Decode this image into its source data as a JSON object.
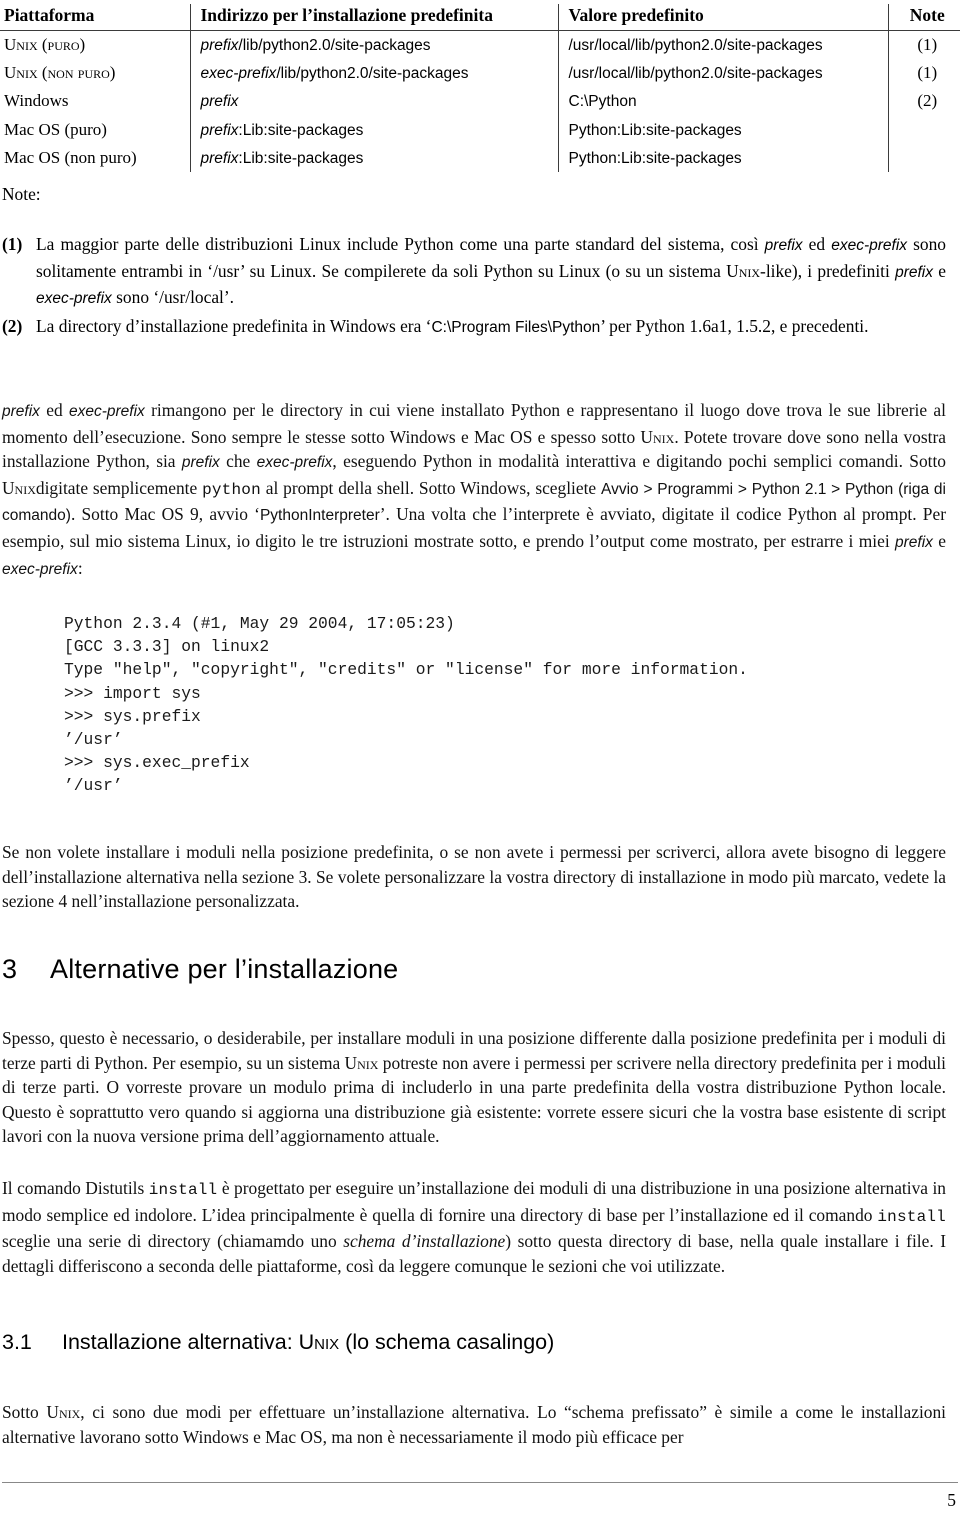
{
  "document": {
    "page_number": "5"
  },
  "table": {
    "headers": [
      "Piattaforma",
      "Indirizzo per l’installazione predefinita",
      "Valore predefinito",
      "Note"
    ],
    "rows": [
      {
        "platform": "Unix (puro)",
        "path_em": "prefix",
        "path_rest": "/lib/python2.0/site-packages",
        "default": "/usr/local/lib/python2.0/site-packages",
        "note": "(1)"
      },
      {
        "platform": "Unix (non puro)",
        "path_em": "exec-prefix",
        "path_rest": "/lib/python2.0/site-packages",
        "default": "/usr/local/lib/python2.0/site-packages",
        "note": "(1)"
      },
      {
        "platform": "Windows",
        "path_em": "prefix",
        "path_rest": "",
        "default": "C:\\Python",
        "note": "(2)"
      },
      {
        "platform": "Mac OS (puro)",
        "path_em": "prefix",
        "path_rest": ":Lib:site-packages",
        "default": "Python:Lib:site-packages",
        "note": ""
      },
      {
        "platform": "Mac OS (non puro)",
        "path_em": "prefix",
        "path_rest": ":Lib:site-packages",
        "default": "Python:Lib:site-packages",
        "note": ""
      }
    ]
  },
  "notes": {
    "label": "Note:",
    "items": [
      {
        "marker": "(1)",
        "p1": "La maggior parte delle distribuzioni Linux include Python come una parte standard del sistema, così ",
        "em1": "prefix",
        "p2": " ed ",
        "em2": "exec-prefix",
        "p3": " sono solitamente entrambi in ‘/usr’ su Linux. Se compilerete da soli Python su Linux (o su un sistema ",
        "sc1": "Unix",
        "p4": "-like), i predefiniti ",
        "em3": "prefix",
        "p5": " e ",
        "em4": "exec-prefix",
        "p6": " sono ‘/usr/local’."
      },
      {
        "marker": "(2)",
        "p1": "La directory d’installazione predefinita in Windows era ‘",
        "em1": "C:\\Program Files\\Python",
        "p2": "’ per Python 1.6a1, 1.5.2, e precedenti."
      }
    ]
  },
  "prefix_paragraph": {
    "em1": "prefix",
    "t1": " ed ",
    "em2": "exec-prefix",
    "t2": " rimangono per le directory in cui viene installato Python e rappresentano il luogo dove trova le sue librerie al momento dell’esecuzione. Sono sempre le stesse sotto Windows e Mac OS e spesso sotto ",
    "sc1": "Unix",
    "t3": ". Potete trovare dove sono nella vostra installazione Python, sia ",
    "em3": "prefix",
    "t4": " che ",
    "em4": "exec-prefix",
    "t5": ", eseguendo Python in modalità interattiva e digitando pochi semplici comandi. Sotto ",
    "sc2": "Unix",
    "t6": "digitate semplicemente ",
    "code1": "python",
    "t7": " al prompt della shell. Sotto Windows, scegliete ",
    "menu": "Avvio  >  Programmi  >  Python 2.1  >  Python (riga di comando)",
    "t8": ". Sotto Mac OS 9, avvio ‘",
    "menu2": "PythonInterpreter",
    "t9": "’. Una volta che l’interprete è avviato, digitate il codice Python al prompt. Per esempio, sul mio sistema Linux, io digito le tre istruzioni mostrate sotto, e prendo l’output come mostrato, per estrarre i miei ",
    "em5": "prefix",
    "t10": " e ",
    "em6": "exec-prefix",
    "t11": ":"
  },
  "code_block": {
    "lines": [
      "Python 2.3.4 (#1, May 29 2004, 17:05:23)",
      "[GCC 3.3.3] on linux2",
      "Type \"help\", \"copyright\", \"credits\" or \"license\" for more information.",
      ">>> import sys",
      ">>> sys.prefix",
      "’/usr’",
      ">>> sys.exec_prefix",
      "’/usr’"
    ]
  },
  "alt_install_paragraph": {
    "text": "Se non volete installare i moduli nella posizione predefinita, o se non avete i permessi per scriverci, allora avete bisogno di leggere dell’installazione alternativa nella sezione  3. Se volete personalizzare la vostra directory di installazione in modo più marcato, vedete la sezione  4 nell’installazione personalizzata."
  },
  "section3": {
    "number": "3",
    "title": "Alternative per l’installazione",
    "para1": {
      "t1": "Spesso, questo è necessario, o desiderabile, per installare moduli in una posizione differente dalla posizione predefinita per i moduli di terze parti di Python. Per esempio, su un sistema ",
      "sc1": "Unix",
      "t2": " potreste non avere i permessi per scrivere nella directory predefinita per i moduli di terze parti. O vorreste provare un modulo prima di includerlo in una parte predefinita della vostra distribuzione Python locale. Questo è soprattutto vero quando si aggiorna una distribuzione già esistente: vorrete essere sicuri che la vostra base esistente di script lavori con la nuova versione prima dell’aggiornamento attuale."
    },
    "para2": {
      "t1": "Il comando Distutils ",
      "code1": "install",
      "t2": " è progettato per eseguire un’installazione dei moduli di una distribuzione in una posizione alternativa in modo semplice ed indolore. L’idea principalmente è quella di fornire una directory di base per l’installazione ed il comando ",
      "code2": "install",
      "t3": " sceglie una serie di directory (chiamamdo uno ",
      "em1": "schema d’installazione",
      "t4": ") sotto questa directory di base, nella quale installare i file. I dettagli differiscono a seconda delle piattaforme, così da leggere comunque le sezioni che voi utilizzate."
    }
  },
  "section31": {
    "number": "3.1",
    "title_before": "Installazione alternativa: ",
    "title_sc": "Unix",
    "title_after": " (lo schema casalingo)",
    "para1": {
      "t1": "Sotto ",
      "sc1": "Unix",
      "t2": ", ci sono due modi per effettuare un’installazione alternativa. Lo “schema prefissato” è simile a come le installazioni alternative lavorano sotto Windows e Mac OS, ma non è necessariamente il modo più efficace per"
    }
  }
}
